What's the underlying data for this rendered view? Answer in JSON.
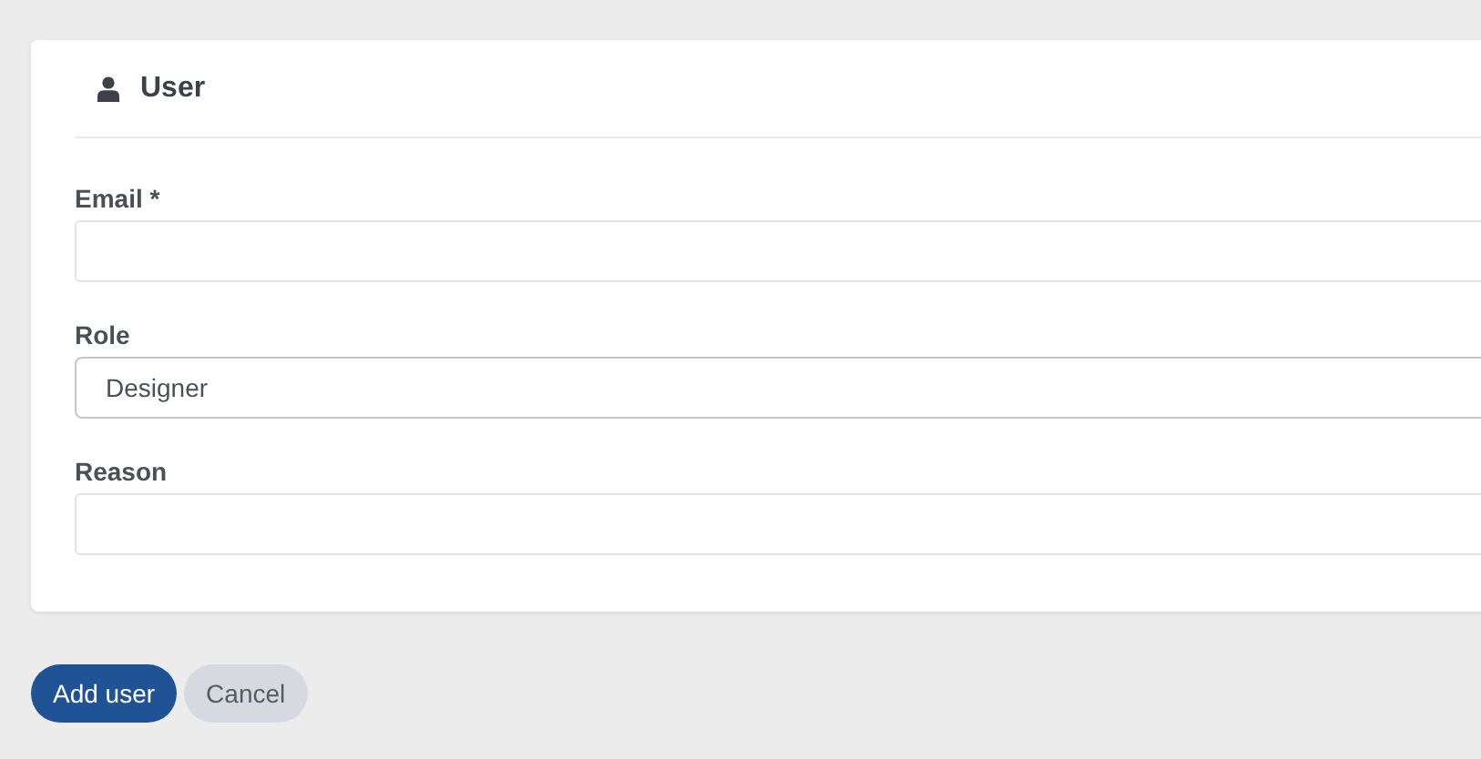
{
  "card": {
    "title": "User"
  },
  "fields": [
    {
      "kind": "input",
      "label": "Email *"
    },
    {
      "kind": "select",
      "label": "Role",
      "value": "Designer"
    },
    {
      "kind": "input",
      "label": "Reason"
    }
  ],
  "buttons": [
    {
      "kind": "primary",
      "label": "Add user"
    },
    {
      "kind": "secondary",
      "label": "Cancel"
    }
  ]
}
